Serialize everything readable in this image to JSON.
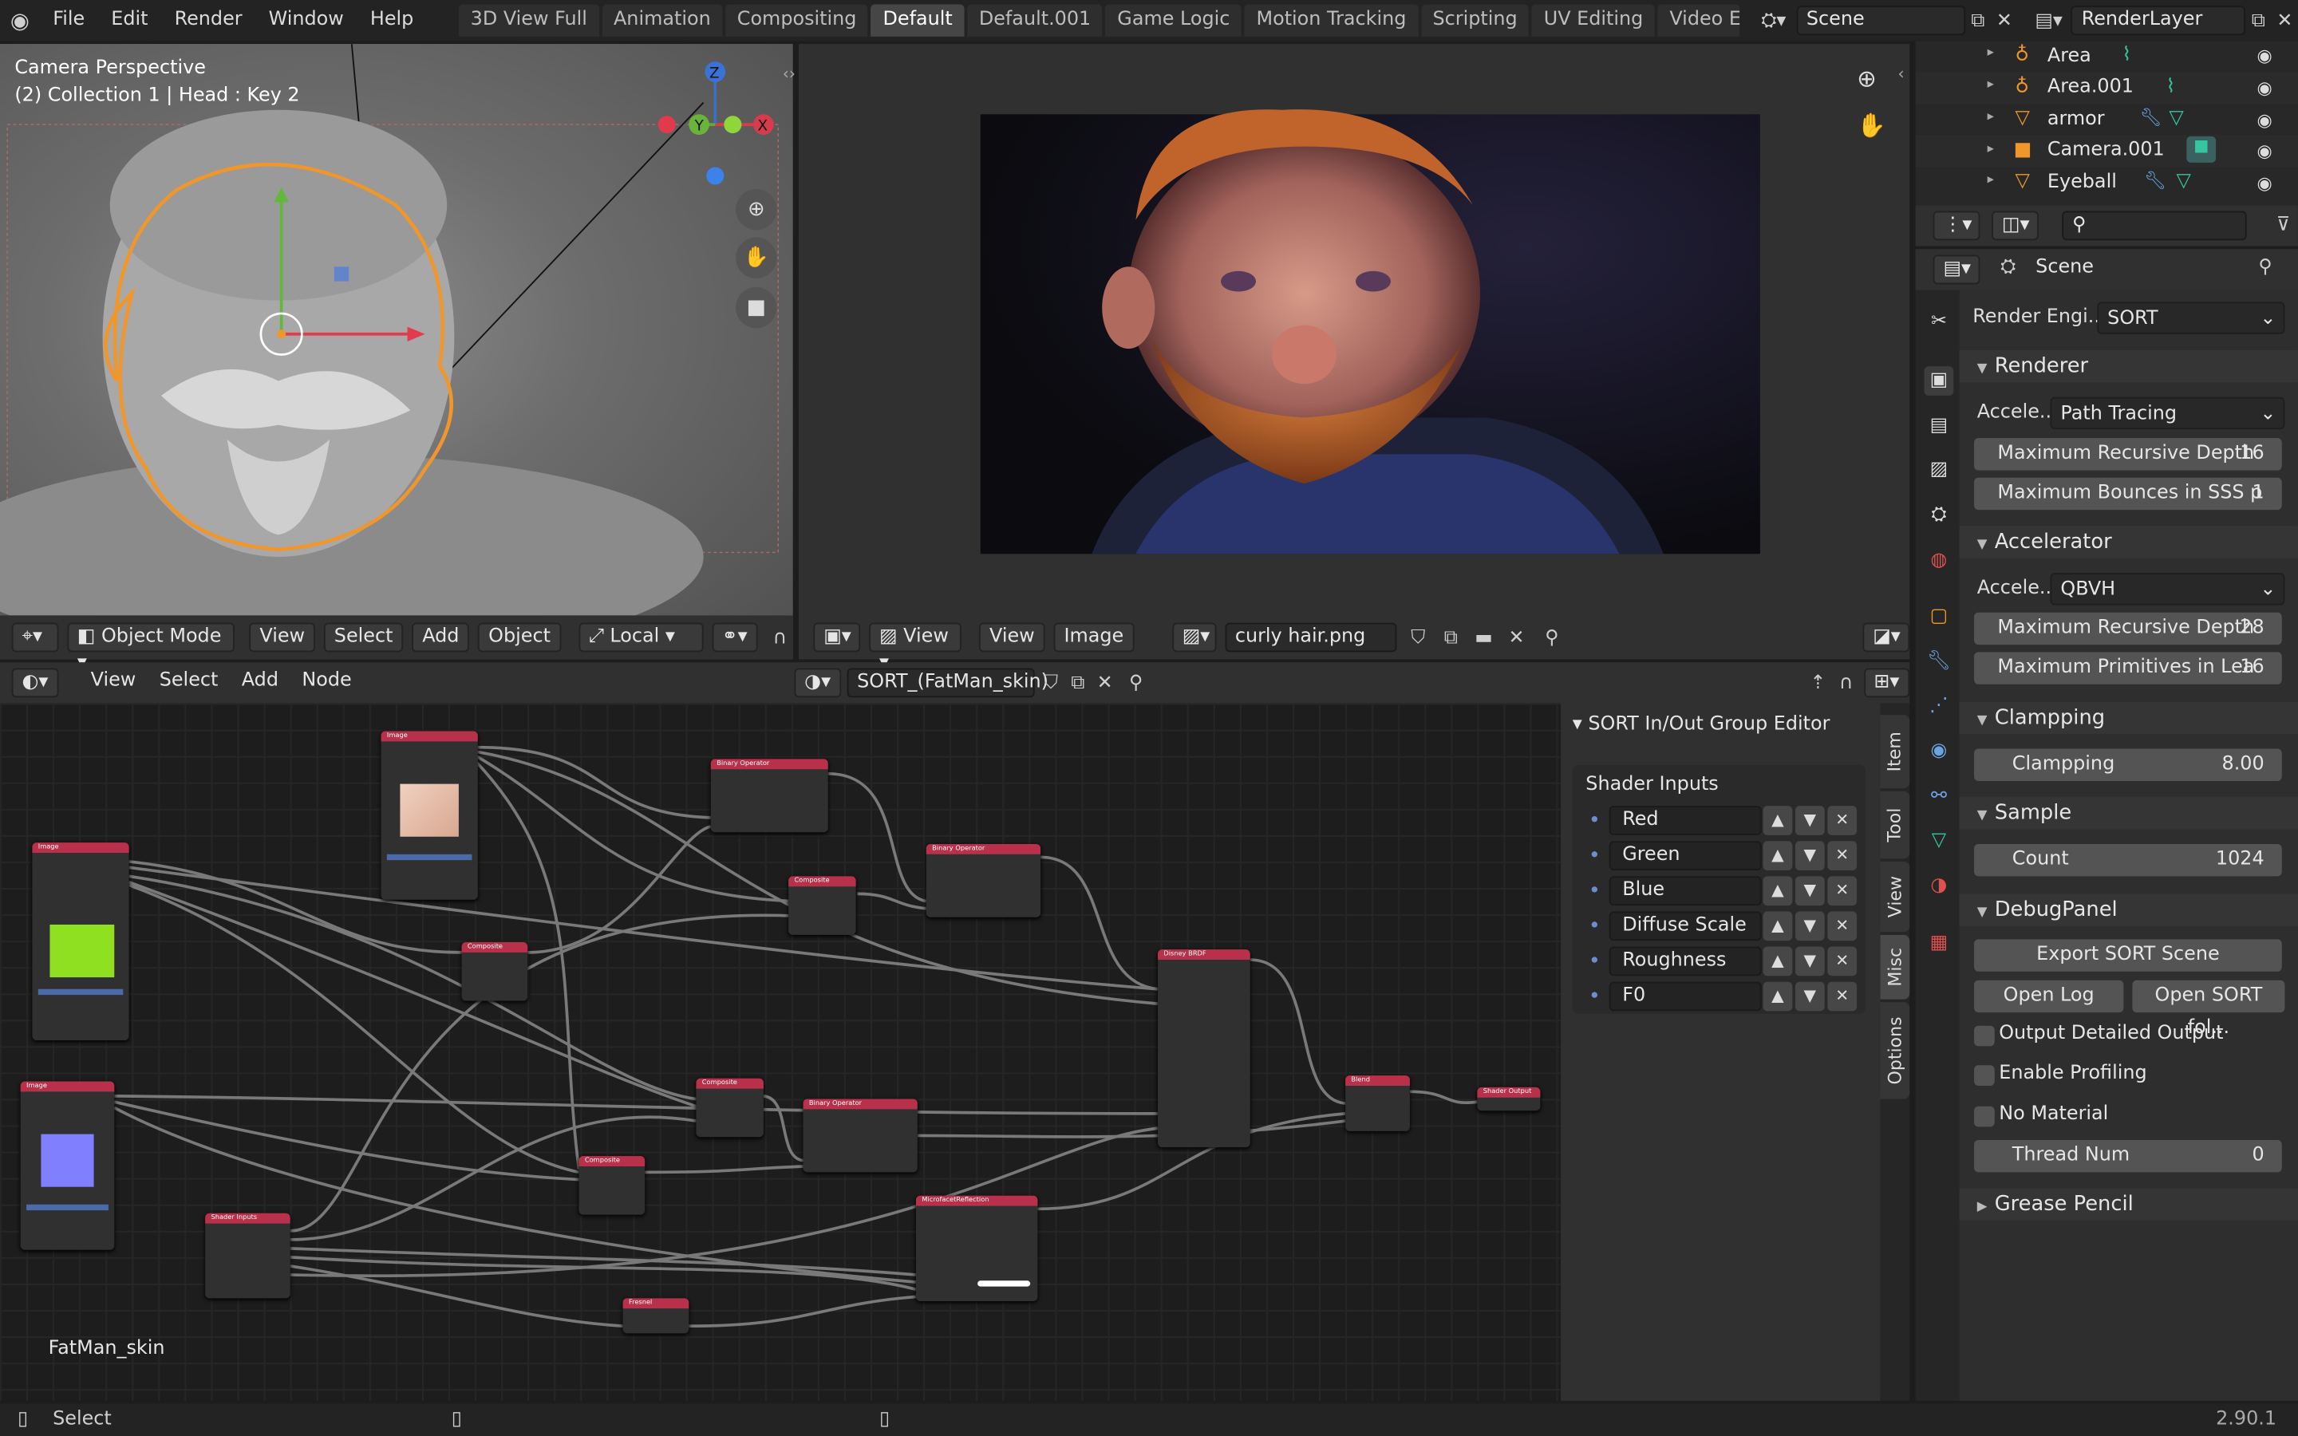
{
  "topbar": {
    "menus": [
      "File",
      "Edit",
      "Render",
      "Window",
      "Help"
    ],
    "workspaces": [
      "3D View Full",
      "Animation",
      "Compositing",
      "Default",
      "Default.001",
      "Game Logic",
      "Motion Tracking",
      "Scripting",
      "UV Editing",
      "Video Edi"
    ],
    "active_workspace": "Default",
    "scene": "Scene",
    "view_layer": "RenderLayer"
  },
  "viewport3d": {
    "title": "Camera Perspective",
    "subtitle": "(2) Collection 1 | Head : Key 2",
    "gizmo_axes": {
      "z": "Z",
      "y": "Y",
      "x": "X"
    },
    "header": {
      "mode": "Object Mode",
      "menus": [
        "View",
        "Select",
        "Add",
        "Object"
      ],
      "orientation": "Local"
    }
  },
  "image_editor": {
    "header": {
      "view_dropdown": "View",
      "menus": [
        "View",
        "Image"
      ],
      "image_name": "curly hair.png"
    }
  },
  "node_editor": {
    "header": {
      "menus": [
        "View",
        "Select",
        "Add",
        "Node"
      ],
      "material": "SORT_(FatMan_skin)"
    },
    "material_label": "FatMan_skin",
    "nodes": {
      "image_a": "Image",
      "image_b": "Image",
      "image_c": "Image",
      "binop_a": "Binary Operator",
      "binop_b": "Binary Operator",
      "binop_c": "Binary Operator",
      "comp_a": "Composite",
      "comp_b": "Composite",
      "comp_c": "Composite",
      "comp_d": "Composite",
      "disney": "Disney BRDF",
      "blend": "Blend",
      "microfacet": "MicrofacetReflection",
      "fresnel": "Fresnel",
      "shader_inputs": "Shader Inputs",
      "shader_output": "Shader Output"
    }
  },
  "npanel": {
    "title": "SORT In/Out Group Editor",
    "box_title": "Shader Inputs",
    "inputs": [
      "Red",
      "Green",
      "Blue",
      "Diffuse Scale",
      "Roughness",
      "F0"
    ],
    "tabs": [
      "Item",
      "Tool",
      "View",
      "Misc",
      "Options"
    ],
    "active_tab": "Misc"
  },
  "outliner": {
    "items": [
      {
        "name": "Area",
        "icon": "light-icon"
      },
      {
        "name": "Area.001",
        "icon": "light-icon"
      },
      {
        "name": "armor",
        "icon": "mesh-icon"
      },
      {
        "name": "Camera.001",
        "icon": "camera-icon"
      },
      {
        "name": "Eyeball",
        "icon": "mesh-icon"
      }
    ]
  },
  "properties": {
    "context": "Scene",
    "render_engine_label": "Render Engi...",
    "render_engine": "SORT",
    "renderer": {
      "title": "Renderer",
      "accel_label": "Accele...",
      "accel_value": "Path Tracing",
      "max_depth_label": "Maximum Recursive Depth",
      "max_depth": "16",
      "max_sss_label": "Maximum Bounces in SSS p",
      "max_sss": "1"
    },
    "accelerator": {
      "title": "Accelerator",
      "accel_label": "Accele...",
      "accel_value": "QBVH",
      "max_depth_label": "Maximum Recursive Depth",
      "max_depth": "28",
      "max_prims_label": "Maximum Primitives in Lea",
      "max_prims": "16"
    },
    "clampping": {
      "title": "Clampping",
      "label": "Clampping",
      "value": "8.00"
    },
    "sample": {
      "title": "Sample",
      "label": "Count",
      "value": "1024"
    },
    "debug": {
      "title": "DebugPanel",
      "export": "Export SORT Scene",
      "open_log": "Open Log",
      "open_folder": "Open SORT fol...",
      "opt_detailed": "Output Detailed Output",
      "opt_profiling": "Enable Profiling",
      "opt_no_material": "No Material",
      "thread_label": "Thread Num",
      "thread_value": "0"
    },
    "grease_pencil": "Grease Pencil"
  },
  "statusbar": {
    "left": "Select",
    "version": "2.90.1"
  }
}
